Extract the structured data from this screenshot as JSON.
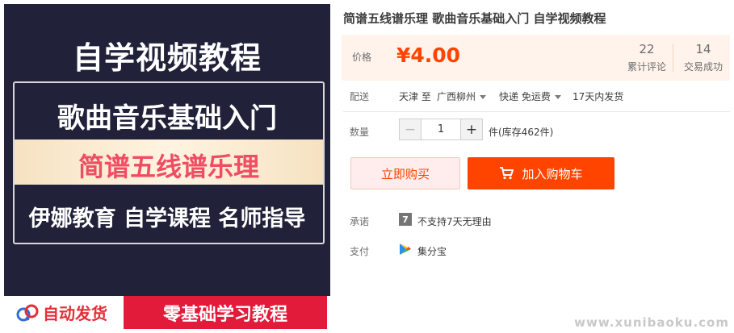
{
  "product_image": {
    "title": "自学视频教程",
    "line1": "歌曲音乐基础入门",
    "band_text": "简谱五线谱乐理",
    "line3": "伊娜教育 自学课程 名师指导",
    "badge_left": "自动发货",
    "badge_right": "零基础学习教程"
  },
  "product": {
    "title": "简谱五线谱乐理 歌曲音乐基础入门 自学视频教程"
  },
  "price": {
    "label": "价格",
    "value": "¥4.00",
    "reviews_count": "22",
    "reviews_label": "累计评论",
    "sales_count": "14",
    "sales_label": "交易成功"
  },
  "shipping": {
    "label": "配送",
    "from": "天津 至",
    "to": "广西柳州",
    "method": "快递 免运费",
    "eta": "17天内发货"
  },
  "quantity": {
    "label": "数量",
    "minus": "−",
    "value": "1",
    "plus": "+",
    "stock": "件(库存462件)"
  },
  "actions": {
    "buy_now": "立即购买",
    "add_to_cart": "加入购物车"
  },
  "promise": {
    "label": "承诺",
    "icon_text": "7",
    "text": "不支持7天无理由"
  },
  "payment": {
    "label": "支付",
    "method": "集分宝"
  },
  "watermark": "www.xunibaoku.com",
  "colors": {
    "accent": "#ff4400",
    "price_bg": "#fff3ec",
    "image_bg": "#21213a",
    "badge_red": "#e31b3b"
  }
}
